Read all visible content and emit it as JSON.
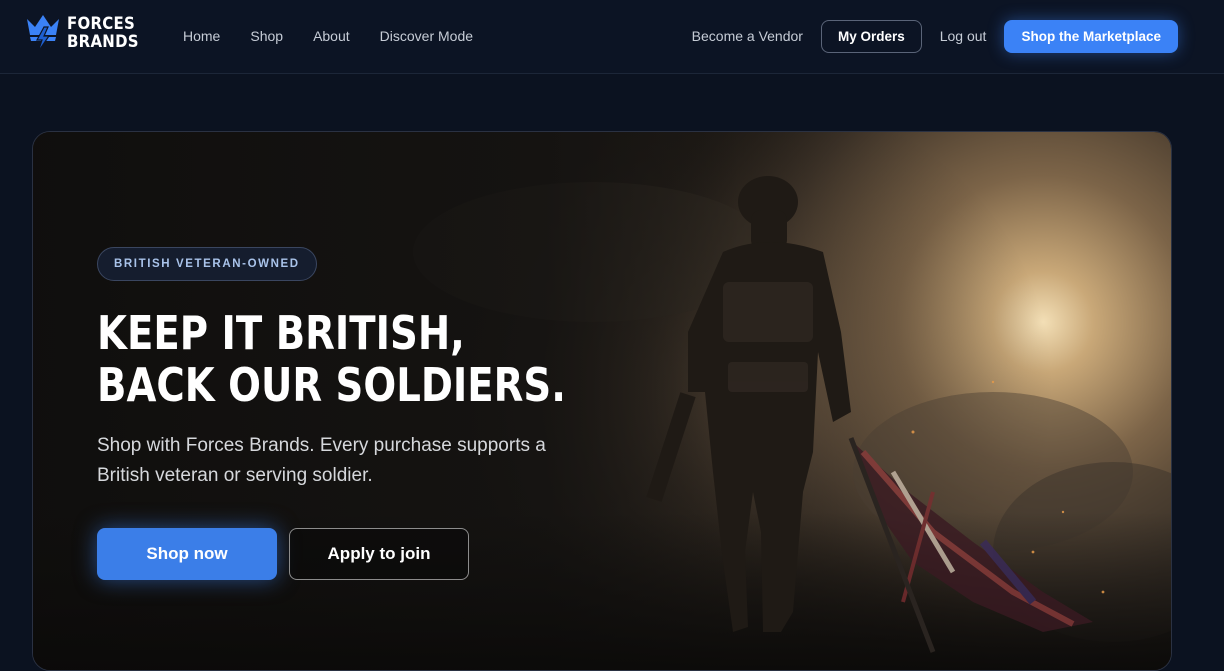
{
  "brand": {
    "line1": "FORCES",
    "line2": "BRANDS",
    "logo_icon": "crown-lightning-icon",
    "accent_color": "#3b82f6"
  },
  "nav": {
    "left": [
      "Home",
      "Shop",
      "About",
      "Discover Mode"
    ],
    "vendor": "Become a Vendor",
    "orders": "My Orders",
    "logout": "Log out",
    "marketplace": "Shop the Marketplace"
  },
  "hero": {
    "badge": "BRITISH VETERAN-OWNED",
    "headline_line1": "KEEP IT BRITISH,",
    "headline_line2": "BACK OUR SOLDIERS.",
    "subtitle": "Shop with Forces Brands. Every purchase supports a British veteran or serving soldier.",
    "primary_cta": "Shop now",
    "secondary_cta": "Apply to join",
    "image": "soldier-with-union-flag-illustration"
  }
}
